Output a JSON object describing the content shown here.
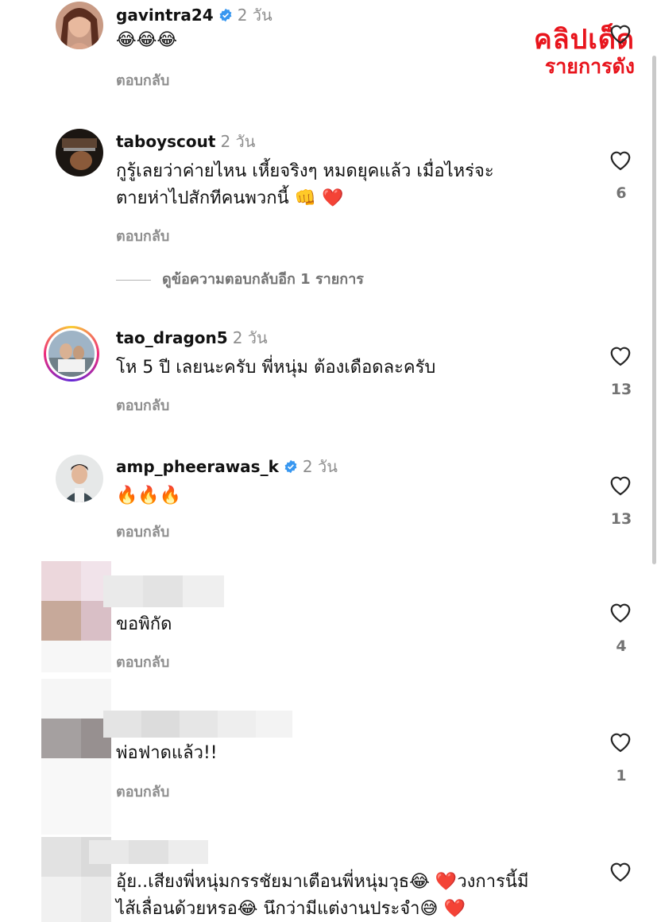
{
  "watermark": {
    "line1": "คลิปเด็ด",
    "line2": "รายการดัง"
  },
  "comments": [
    {
      "username": "gavintra24",
      "verified": true,
      "time": "2 วัน",
      "text": "😂😂😂",
      "reply": "ตอบกลับ",
      "likes": ""
    },
    {
      "username": "taboyscout",
      "verified": false,
      "time": "2 วัน",
      "text_line1": "กูรู้เลยว่าค่ายไหน เหี้ยจริงๆ หมดยุคแล้ว เมื่อไหร่จะ",
      "text_line2": "ตายห่าไปสักทีคนพวกนี้ 👊 ❤️",
      "reply": "ตอบกลับ",
      "likes": "6"
    },
    {
      "username": "tao_dragon5",
      "verified": false,
      "time": "2 วัน",
      "text": "โห 5 ปี เลยนะครับ พี่หนุ่ม ต้องเดือดละครับ",
      "reply": "ตอบกลับ",
      "likes": "13"
    },
    {
      "username": "amp_pheerawas_k",
      "verified": true,
      "time": "2 วัน",
      "text": "🔥🔥🔥",
      "reply": "ตอบกลับ",
      "likes": "13"
    },
    {
      "username": "",
      "text": "ขอพิกัด",
      "reply": "ตอบกลับ",
      "likes": "4"
    },
    {
      "username": "",
      "text": "พ่อฟาดแล้ว!!",
      "reply": "ตอบกลับ",
      "likes": "1"
    },
    {
      "username": "",
      "text_line1": "อุ้ย..เสียงพี่หนุ่มกรรชัยมาเตือนพี่หนุ่มวุธ😂 ❤️วงการนี้มี",
      "text_line2": "ไส้เลื่อนด้วยหรอ😂 นึกว่ามีแต่งานประจำ😅 ❤️",
      "likes": ""
    }
  ],
  "view_more_replies": "ดูข้อความตอบกลับอีก 1 รายการ",
  "icons": {
    "heart": "heart-outline-icon",
    "verified": "verified-badge-icon"
  },
  "colors": {
    "verified": "#3897f0",
    "watermark": "#e8141c",
    "muted": "#8e8e8e"
  }
}
